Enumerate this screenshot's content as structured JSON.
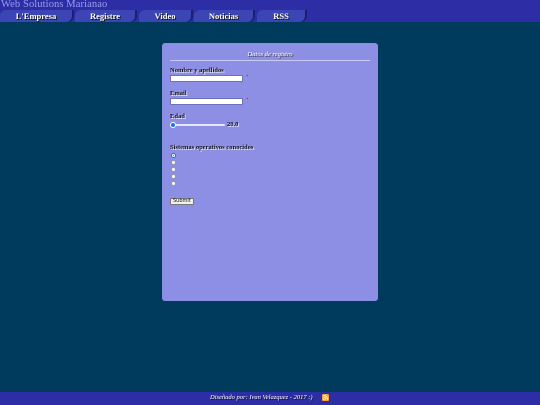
{
  "site": {
    "title": "Web Solutions Marianao"
  },
  "nav": {
    "items": [
      {
        "label": "L'Empresa"
      },
      {
        "label": "Registre"
      },
      {
        "label": "Video"
      },
      {
        "label": "Noticias"
      },
      {
        "label": "RSS"
      }
    ]
  },
  "form": {
    "legend": "Datos de registro",
    "name_label": "Nombre y apellidos",
    "name_value": "",
    "email_label": "Email",
    "email_value": "",
    "required_mark": "*",
    "age_label": "Edad",
    "age_value": "20.0",
    "os_label": "Sistemas operativos conocidos",
    "os_options": [
      {
        "label": "",
        "checked": true
      },
      {
        "label": "",
        "checked": false
      },
      {
        "label": "",
        "checked": false
      },
      {
        "label": "",
        "checked": false
      },
      {
        "label": "",
        "checked": false
      }
    ],
    "submit_label": "Submit"
  },
  "footer": {
    "text": "Diseñado por: Ivan Velazquez - 2017 :)",
    "icon": "rss-icon"
  },
  "colors": {
    "background": "#003a5c",
    "header": "#2d2ea6",
    "nav_tab": "#3b45b4",
    "panel": "#8d8fe4",
    "site_title": "#9c9cec",
    "required": "#c2185b"
  }
}
